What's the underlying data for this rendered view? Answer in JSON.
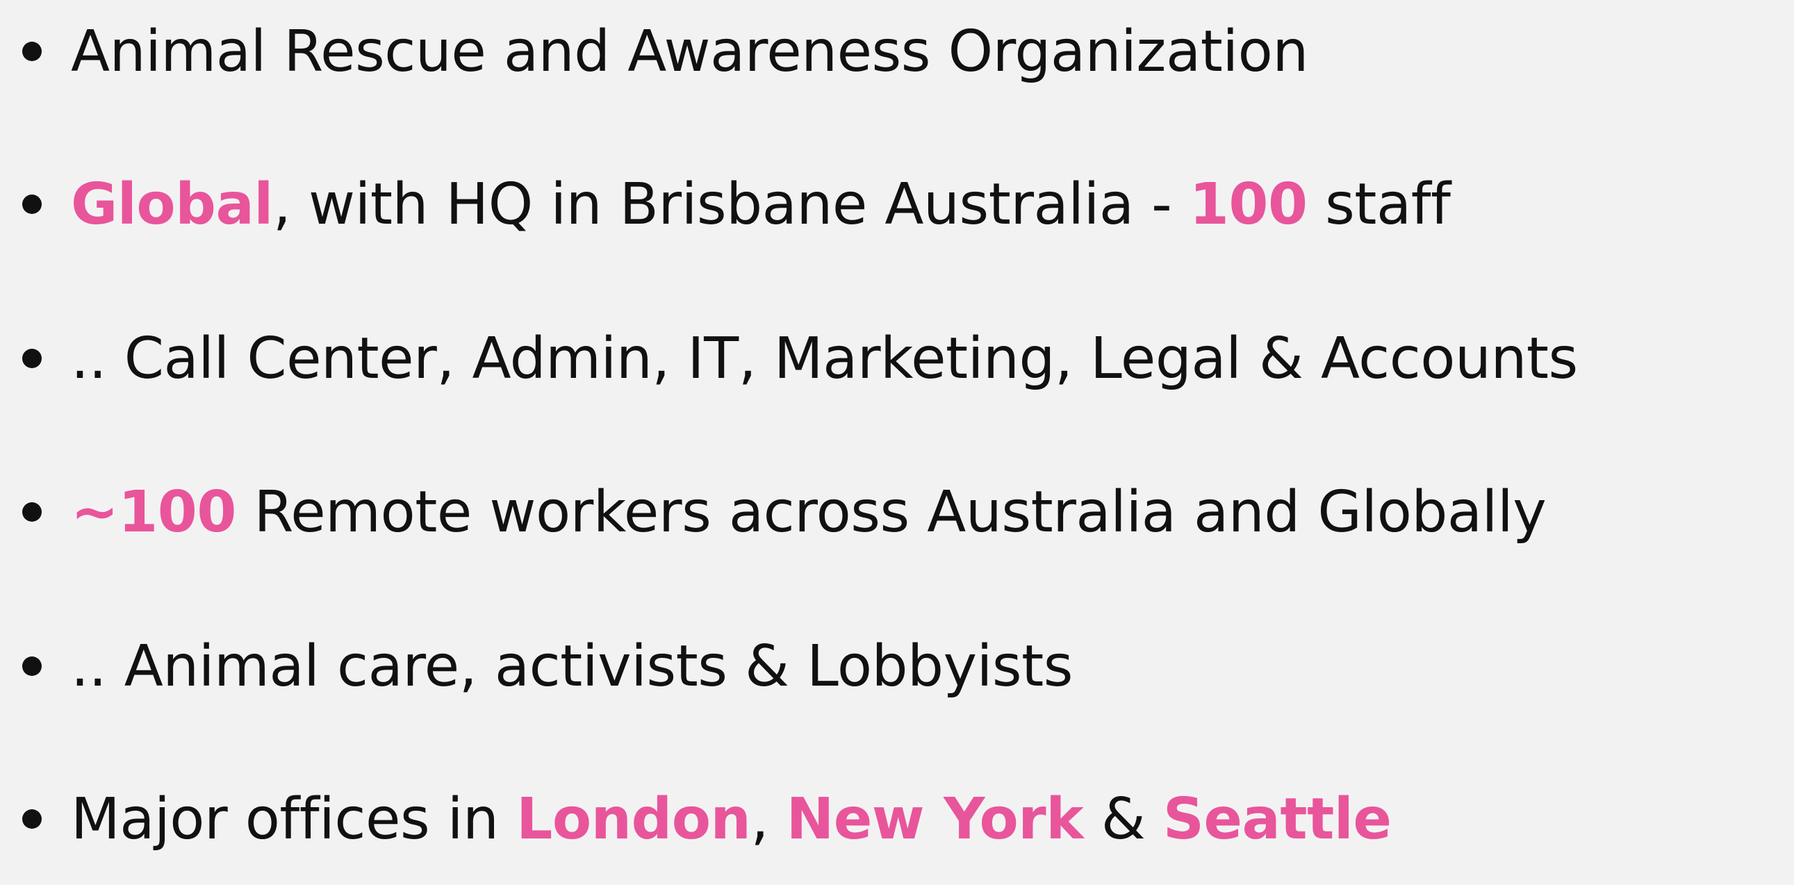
{
  "colors": {
    "background": "#f3f2f2",
    "text": "#111111",
    "highlight": "#e8559b"
  },
  "bullets": [
    {
      "icon": "bullet-dot-icon",
      "text": "Animal Rescue and Awareness Organization"
    },
    {
      "icon": "bullet-dot-icon",
      "highlight_1": "Global",
      "text_1": ", with HQ in Brisbane Australia - ",
      "highlight_2": "100",
      "text_2": " staff"
    },
    {
      "icon": "bullet-dot-icon",
      "text": ".. Call Center, Admin, IT, Marketing, Legal & Accounts"
    },
    {
      "icon": "bullet-dot-icon",
      "highlight_1": "~100",
      "text_1": " Remote workers across Australia and Globally"
    },
    {
      "icon": "bullet-dot-icon",
      "text": ".. Animal care, activists & Lobbyists"
    },
    {
      "icon": "bullet-dot-icon",
      "text_1": "Major offices in ",
      "highlight_1": "London",
      "text_2": ", ",
      "highlight_2": "New York",
      "text_3": " & ",
      "highlight_3": "Seattle"
    }
  ]
}
